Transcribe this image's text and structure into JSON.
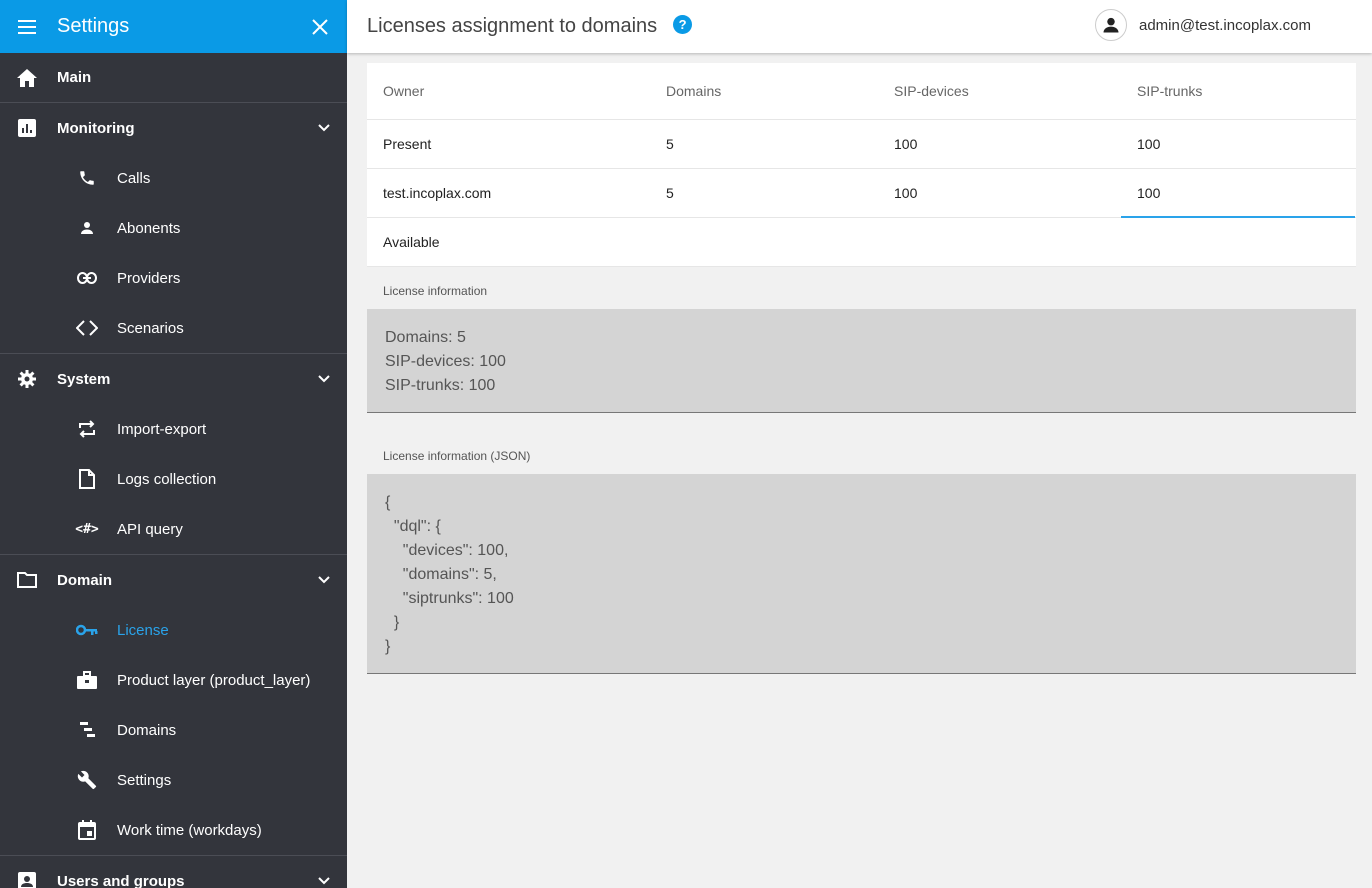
{
  "sidebar": {
    "title": "Settings",
    "sections": {
      "main": "Main",
      "monitoring": "Monitoring",
      "system": "System",
      "domain": "Domain",
      "users": "Users and groups"
    },
    "monitoring_items": [
      "Calls",
      "Abonents",
      "Providers",
      "Scenarios"
    ],
    "system_items": [
      "Import-export",
      "Logs collection",
      "API query"
    ],
    "domain_items": [
      "License",
      "Product layer (product_layer)",
      "Domains",
      "Settings",
      "Work time (workdays)"
    ],
    "active_item": "License",
    "active_color": "#2aa3ea",
    "header_color": "#0a9ae6"
  },
  "header": {
    "title": "Licenses assignment to domains",
    "help": "?",
    "user": "admin@test.incoplax.com"
  },
  "table": {
    "columns": [
      "Owner",
      "Domains",
      "SIP-devices",
      "SIP-trunks"
    ],
    "rows": [
      [
        "Present",
        "5",
        "100",
        "100"
      ],
      [
        "test.incoplax.com",
        "5",
        "100",
        "100"
      ],
      [
        "Available",
        "",
        "",
        ""
      ]
    ]
  },
  "license_info": {
    "label": "License information",
    "text": "Domains: 5\nSIP-devices: 100\nSIP-trunks: 100"
  },
  "license_json": {
    "label": "License information (JSON)",
    "text": "{\n  \"dql\": {\n    \"devices\": 100,\n    \"domains\": 5,\n    \"siptrunks\": 100\n  }\n}"
  }
}
